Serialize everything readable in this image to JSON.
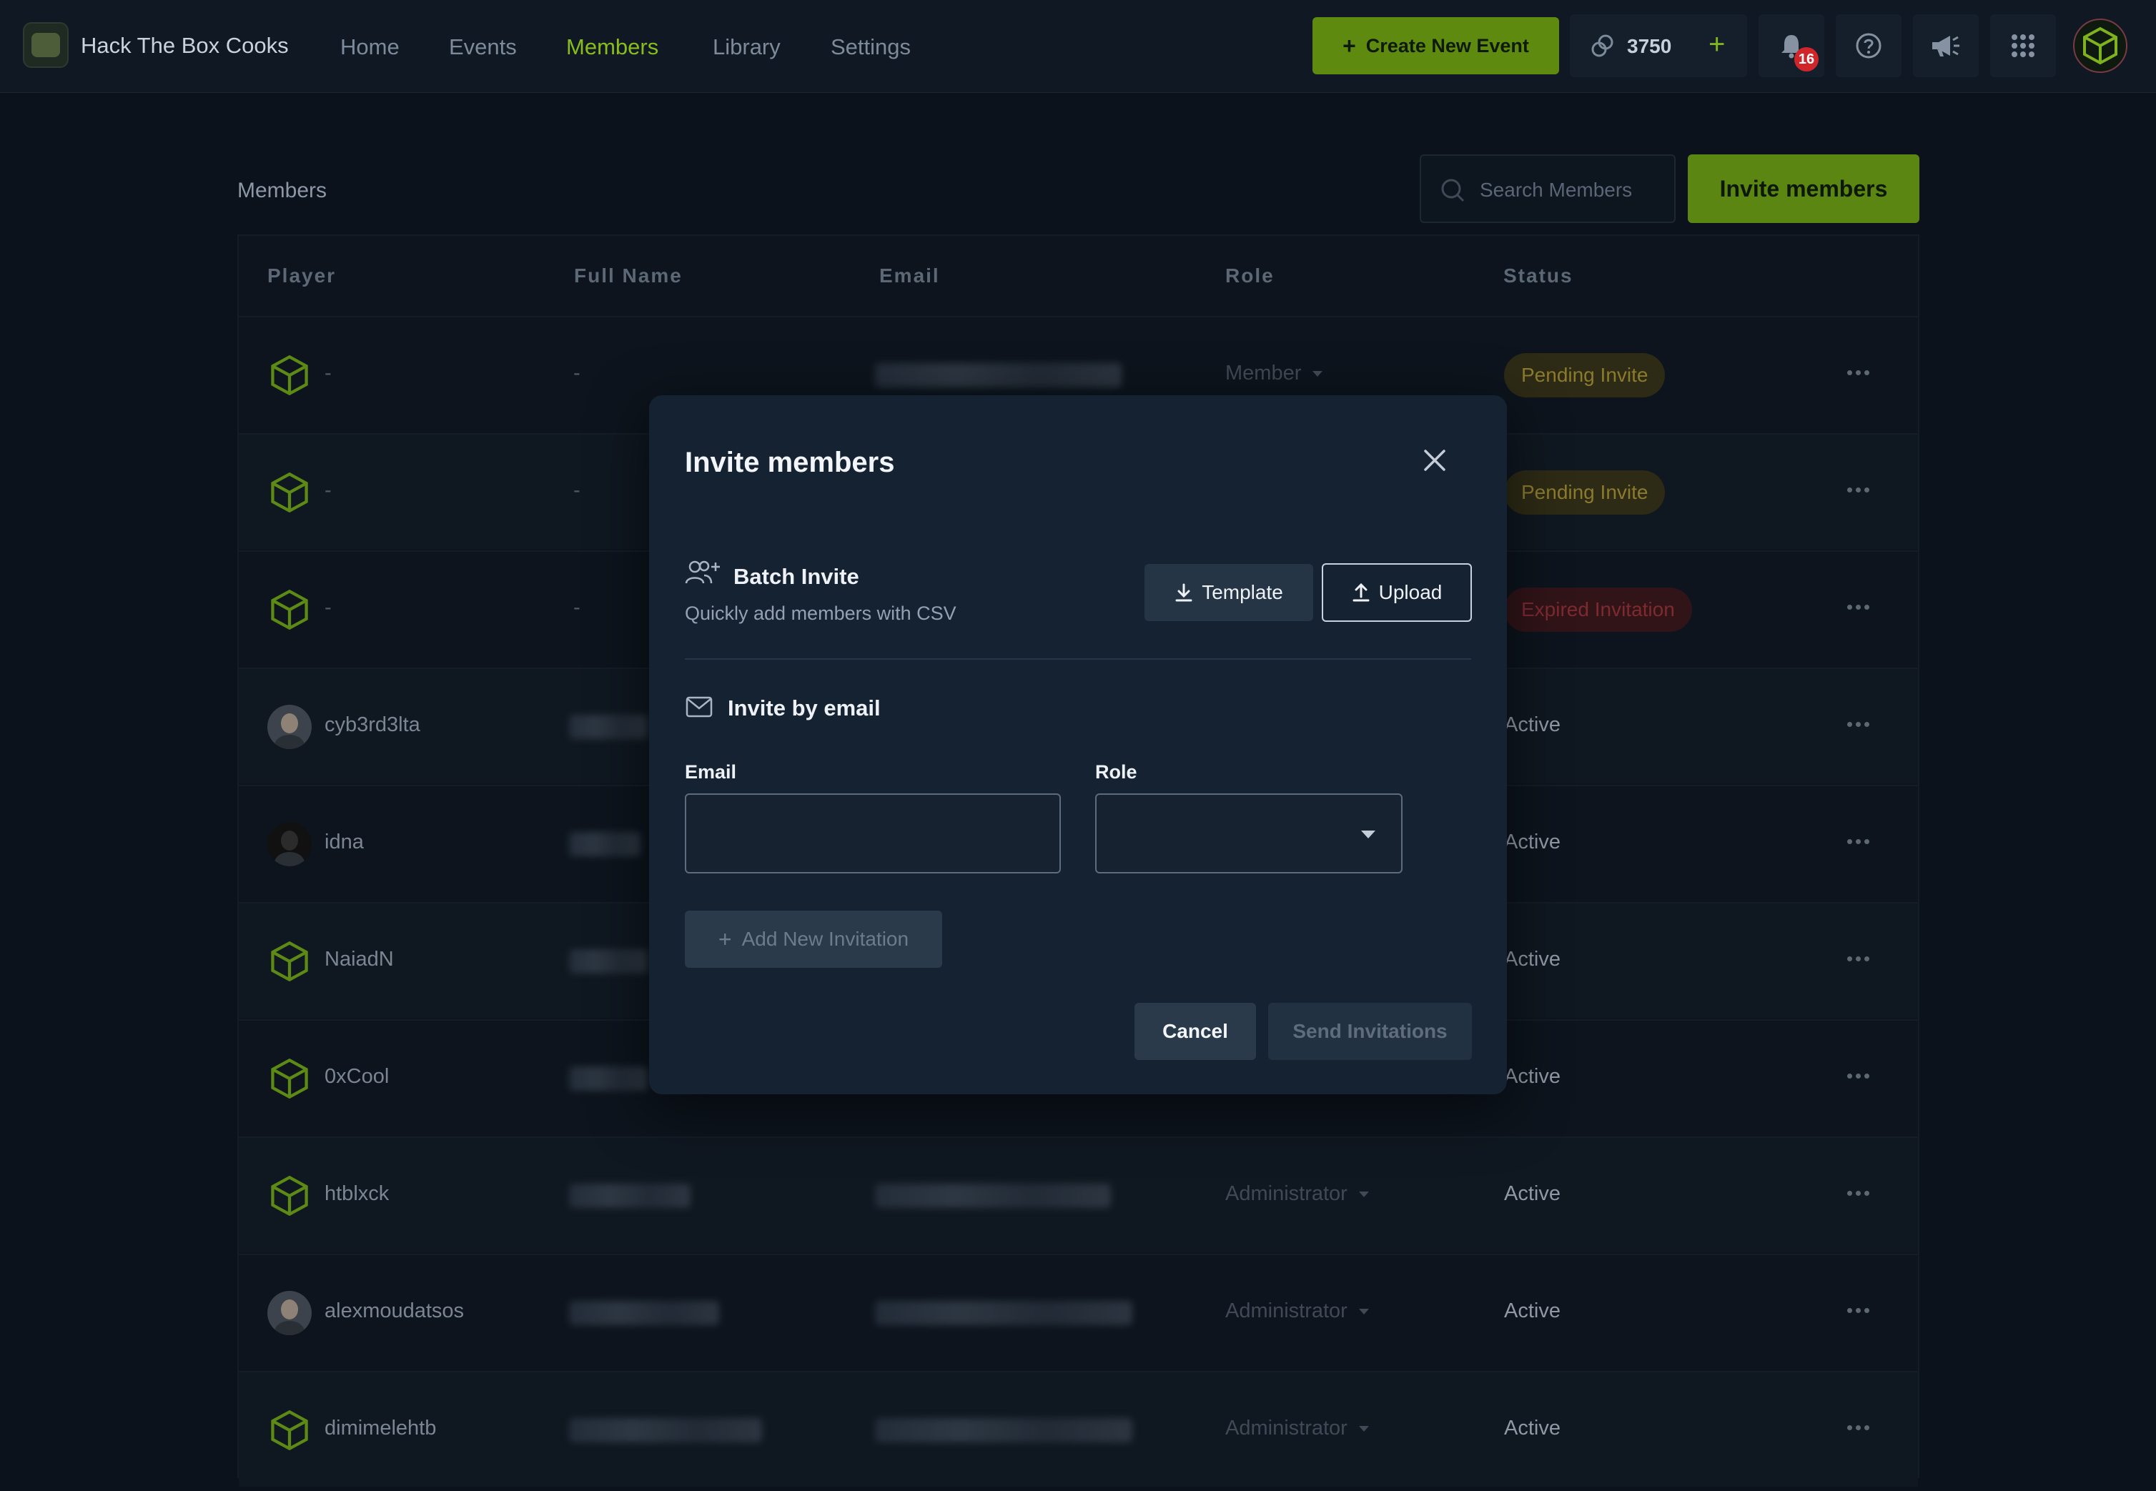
{
  "app": {
    "brand": "Hack The Box Cooks",
    "nav": [
      {
        "label": "Home",
        "active": false
      },
      {
        "label": "Events",
        "active": false
      },
      {
        "label": "Members",
        "active": true
      },
      {
        "label": "Library",
        "active": false
      },
      {
        "label": "Settings",
        "active": false
      }
    ],
    "create_event_label": "Create New Event",
    "credits": "3750",
    "notifications_count": "16",
    "accent_color": "#5f8a10"
  },
  "members_page": {
    "title": "Members",
    "search_placeholder": "Search Members",
    "invite_button": "Invite members",
    "columns": [
      "Player",
      "Full Name",
      "Email",
      "Role",
      "Status"
    ],
    "rows": [
      {
        "player": "-",
        "full_name": "-",
        "role": "Member",
        "status": "Pending Invite",
        "status_kind": "pending",
        "avatar": "cube"
      },
      {
        "player": "-",
        "full_name": "-",
        "role": "",
        "status": "Pending Invite",
        "status_kind": "pending",
        "avatar": "cube"
      },
      {
        "player": "-",
        "full_name": "-",
        "role": "",
        "status": "Expired Invitation",
        "status_kind": "expired",
        "avatar": "cube"
      },
      {
        "player": "cyb3rd3lta",
        "full_name": "",
        "role": "",
        "status": "Active",
        "status_kind": "active",
        "avatar": "photo"
      },
      {
        "player": "idna",
        "full_name": "",
        "role": "",
        "status": "Active",
        "status_kind": "active",
        "avatar": "photo-dark"
      },
      {
        "player": "NaiadN",
        "full_name": "",
        "role": "",
        "status": "Active",
        "status_kind": "active",
        "avatar": "cube"
      },
      {
        "player": "0xCool",
        "full_name": "",
        "role": "",
        "status": "Active",
        "status_kind": "active",
        "avatar": "cube"
      },
      {
        "player": "htblxck",
        "full_name": "",
        "role": "Administrator",
        "status": "Active",
        "status_kind": "active",
        "avatar": "cube"
      },
      {
        "player": "alexmoudatsos",
        "full_name": "",
        "role": "Administrator",
        "status": "Active",
        "status_kind": "active",
        "avatar": "photo"
      },
      {
        "player": "dimimelehtb",
        "full_name": "",
        "role": "Administrator",
        "status": "Active",
        "status_kind": "active",
        "avatar": "cube"
      }
    ]
  },
  "modal": {
    "title": "Invite members",
    "batch": {
      "title": "Batch Invite",
      "subtitle": "Quickly add members with CSV",
      "template_label": "Template",
      "upload_label": "Upload"
    },
    "by_email": {
      "title": "Invite by email",
      "email_label": "Email",
      "email_value": "",
      "role_label": "Role",
      "role_value": "",
      "add_label": "Add New Invitation"
    },
    "cancel_label": "Cancel",
    "send_label": "Send Invitations"
  }
}
